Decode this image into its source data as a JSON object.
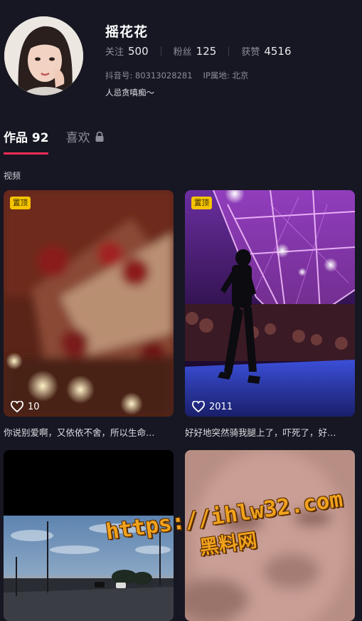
{
  "profile": {
    "name": "摇花花",
    "stats": [
      {
        "label": "关注",
        "value": "500"
      },
      {
        "label": "粉丝",
        "value": "125"
      },
      {
        "label": "获赞",
        "value": "4516"
      }
    ],
    "douyin_id": "抖音号: 80313028281",
    "ip_location": "IP属地: 北京",
    "bio": "人忌贪嗔痴～"
  },
  "tabs": {
    "works": "作品 92",
    "likes": "喜欢"
  },
  "section_label": "视频",
  "videos": [
    {
      "badge": "置顶",
      "likes": "10",
      "caption": "你说别爱啊，又依依不舍，所以生命…"
    },
    {
      "badge": "置顶",
      "likes": "2011",
      "caption": "好好地突然骑我腿上了，吓死了，好…"
    },
    {},
    {}
  ],
  "watermark": {
    "url": "https://ihlw32.com",
    "text": "黑料网"
  },
  "colors": {
    "background": "#161722",
    "accent": "#fe2c55",
    "badge": "#f5c400",
    "watermark": "#f0a21c"
  },
  "icons": [
    "lock-icon",
    "heart-icon"
  ]
}
